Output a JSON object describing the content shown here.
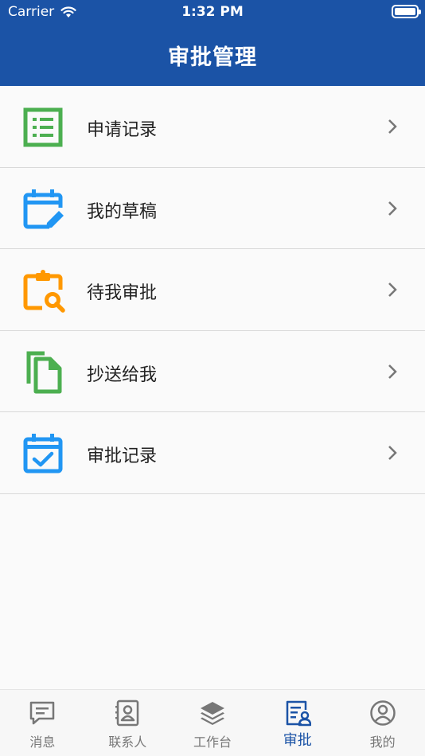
{
  "status_bar": {
    "carrier": "Carrier",
    "time": "1:32 PM"
  },
  "header": {
    "title": "审批管理"
  },
  "menu": [
    {
      "label": "申请记录",
      "icon": "list-document-icon",
      "color": "#4caf50"
    },
    {
      "label": "我的草稿",
      "icon": "calendar-edit-icon",
      "color": "#2196f3"
    },
    {
      "label": "待我审批",
      "icon": "clipboard-search-icon",
      "color": "#ff9800"
    },
    {
      "label": "抄送给我",
      "icon": "copy-files-icon",
      "color": "#4caf50"
    },
    {
      "label": "审批记录",
      "icon": "calendar-check-icon",
      "color": "#2196f3"
    }
  ],
  "tabbar": {
    "active_index": 3,
    "active_color": "#1b53a6",
    "items": [
      {
        "label": "消息",
        "icon": "message-icon"
      },
      {
        "label": "联系人",
        "icon": "contacts-icon"
      },
      {
        "label": "工作台",
        "icon": "layers-icon"
      },
      {
        "label": "审批",
        "icon": "approval-icon"
      },
      {
        "label": "我的",
        "icon": "profile-icon"
      }
    ]
  }
}
